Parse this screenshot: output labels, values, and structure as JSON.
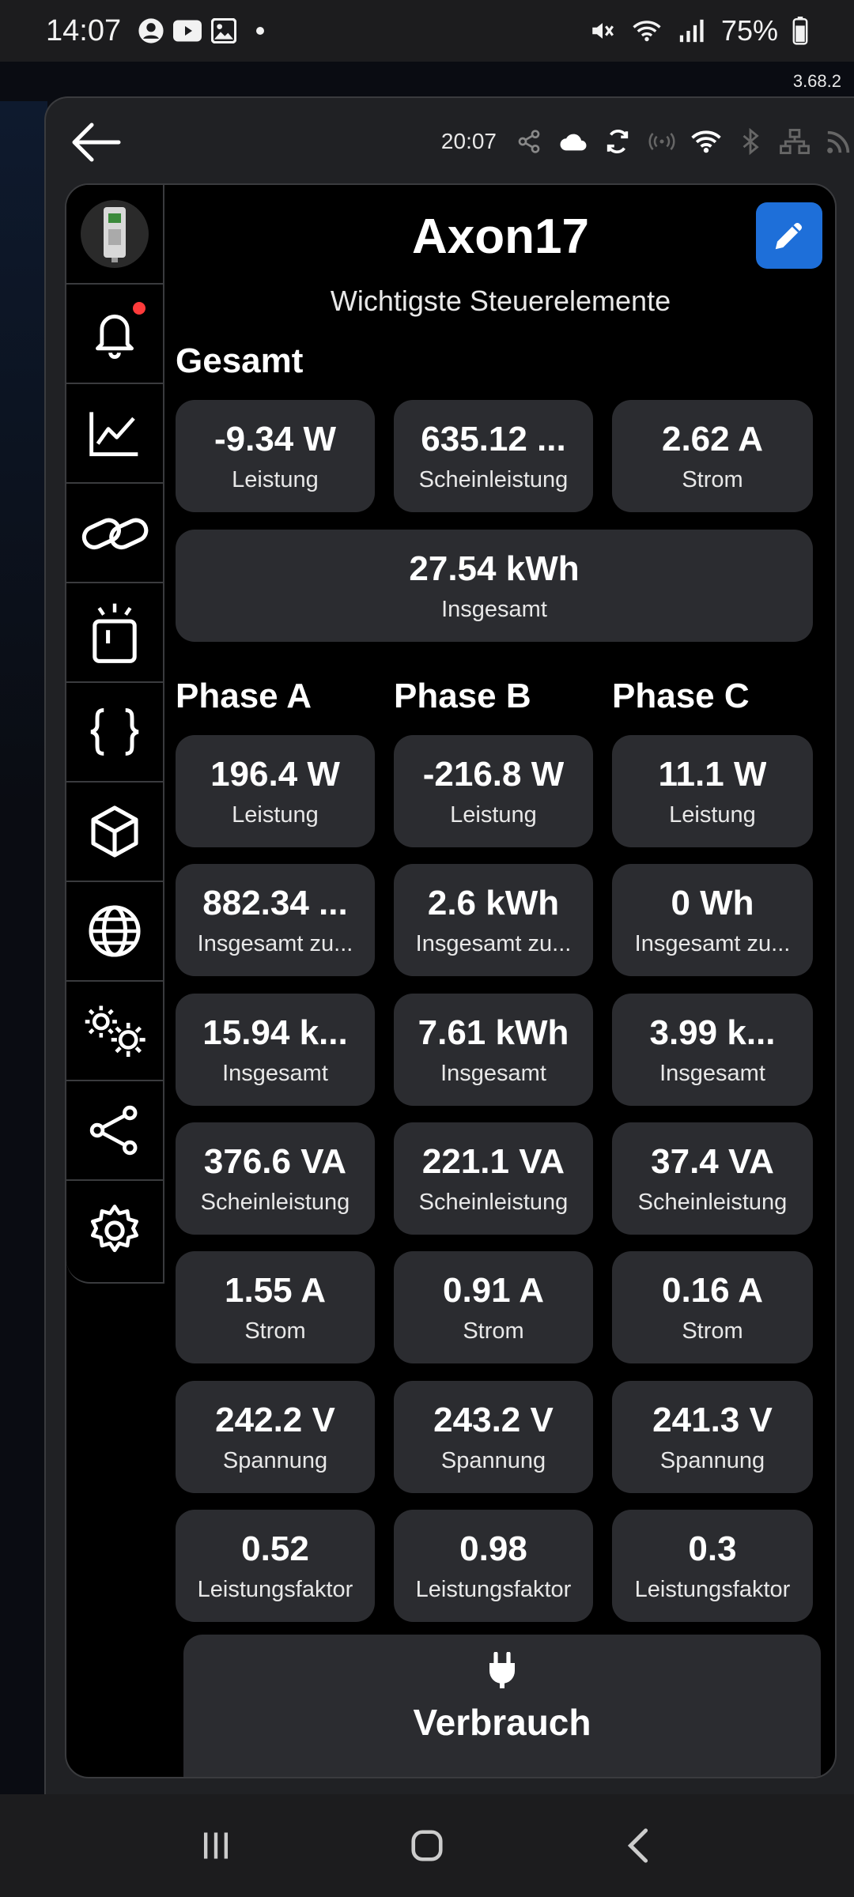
{
  "status_bar": {
    "time": "14:07",
    "battery_pct": "75%"
  },
  "app_version": "3.68.2",
  "topbar": {
    "clock": "20:07"
  },
  "header": {
    "title": "Axon17",
    "subtitle": "Wichtigste Steuerelemente"
  },
  "sections": {
    "gesamt": "Gesamt",
    "phase_a": "Phase A",
    "phase_b": "Phase B",
    "phase_c": "Phase C"
  },
  "gesamt_tiles": [
    {
      "value": "-9.34 W",
      "label": "Leistung"
    },
    {
      "value": "635.12 ...",
      "label": "Scheinleistung"
    },
    {
      "value": "2.62 A",
      "label": "Strom"
    }
  ],
  "gesamt_total": {
    "value": "27.54 kWh",
    "label": "Insgesamt"
  },
  "phase_rows": [
    [
      {
        "value": "196.4 W",
        "label": "Leistung"
      },
      {
        "value": "-216.8 W",
        "label": "Leistung"
      },
      {
        "value": "11.1 W",
        "label": "Leistung"
      }
    ],
    [
      {
        "value": "882.34 ...",
        "label": "Insgesamt zu..."
      },
      {
        "value": "2.6 kWh",
        "label": "Insgesamt zu..."
      },
      {
        "value": "0 Wh",
        "label": "Insgesamt zu..."
      }
    ],
    [
      {
        "value": "15.94 k...",
        "label": "Insgesamt"
      },
      {
        "value": "7.61 kWh",
        "label": "Insgesamt"
      },
      {
        "value": "3.99 k...",
        "label": "Insgesamt"
      }
    ],
    [
      {
        "value": "376.6 VA",
        "label": "Scheinleistung"
      },
      {
        "value": "221.1 VA",
        "label": "Scheinleistung"
      },
      {
        "value": "37.4 VA",
        "label": "Scheinleistung"
      }
    ],
    [
      {
        "value": "1.55 A",
        "label": "Strom"
      },
      {
        "value": "0.91 A",
        "label": "Strom"
      },
      {
        "value": "0.16 A",
        "label": "Strom"
      }
    ],
    [
      {
        "value": "242.2 V",
        "label": "Spannung"
      },
      {
        "value": "243.2 V",
        "label": "Spannung"
      },
      {
        "value": "241.3 V",
        "label": "Spannung"
      }
    ],
    [
      {
        "value": "0.52",
        "label": "Leistungsfaktor"
      },
      {
        "value": "0.98",
        "label": "Leistungsfaktor"
      },
      {
        "value": "0.3",
        "label": "Leistungsfaktor"
      }
    ]
  ],
  "verbrauch": {
    "label": "Verbrauch",
    "icon": "plug-icon"
  },
  "sidenav_icons": [
    "device-image",
    "bell-icon",
    "chart-icon",
    "link-icon",
    "device-light-icon",
    "braces-icon",
    "cube-icon",
    "globe-icon",
    "gears-icon",
    "share-icon",
    "gear-icon"
  ],
  "colors": {
    "accent": "#1e6fd9",
    "tile": "#2b2c30",
    "notification": "#ff3b3b"
  }
}
